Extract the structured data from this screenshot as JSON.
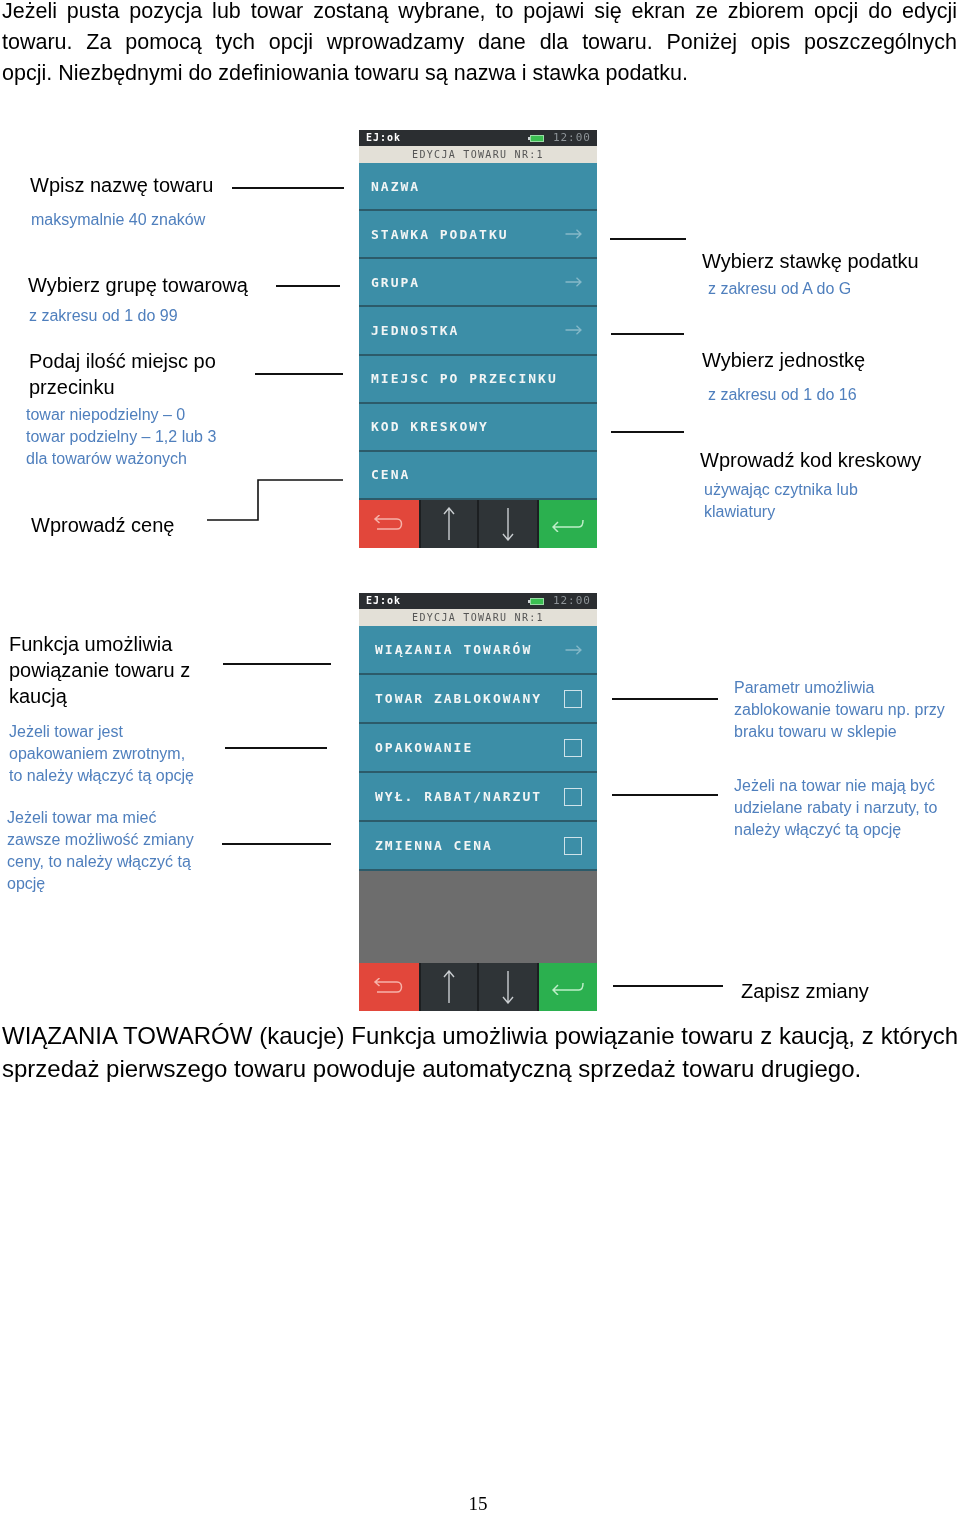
{
  "intro": [
    "Jeżeli pusta pozycja lub towar zostaną wybrane, to pojawi się ekran ze zbiorem opcji do edycji",
    "towaru. Za pomocą tych opcji wprowadzamy dane dla towaru. Poniżej opis poszczególnych",
    "opcji. Niezbędnymi do zdefiniowania towaru są nazwa i stawka podatku."
  ],
  "figures": [
    {
      "left": [
        {
          "kind": "title",
          "lines": [
            "Wpisz nazwę towaru"
          ]
        },
        {
          "kind": "note",
          "lines": [
            "maksymalnie 40 znaków"
          ]
        },
        {
          "kind": "title",
          "lines": [
            "Wybierz grupę towarową"
          ]
        },
        {
          "kind": "note",
          "lines": [
            "z zakresu od 1 do 99"
          ]
        },
        {
          "kind": "title",
          "lines": [
            "Podaj ilość miejsc po",
            "przecinku"
          ]
        },
        {
          "kind": "note",
          "lines": [
            "towar niepodzielny – 0",
            "towar podzielny – 1,2 lub 3",
            "dla towarów ważonych"
          ]
        },
        {
          "kind": "title",
          "lines": [
            "Wprowadź cenę"
          ]
        }
      ],
      "device": {
        "status_text": "EJ:ok",
        "time": "12:00",
        "title": "EDYCJA TOWARU NR:1",
        "items": [
          {
            "label": "NAZWA",
            "kind": "plain"
          },
          {
            "label": "STAWKA PODATKU",
            "kind": "arrow"
          },
          {
            "label": "GRUPA",
            "kind": "arrow"
          },
          {
            "label": "JEDNOSTKA",
            "kind": "arrow"
          },
          {
            "label": "MIEJSC PO PRZECINKU",
            "kind": "plain"
          },
          {
            "label": "KOD KRESKOWY",
            "kind": "plain"
          },
          {
            "label": "CENA",
            "kind": "plain"
          }
        ]
      },
      "right": [
        {
          "kind": "title",
          "lines": [
            "Wybierz stawkę podatku"
          ]
        },
        {
          "kind": "note",
          "lines": [
            "z zakresu od A do G"
          ]
        },
        {
          "kind": "title",
          "lines": [
            "Wybierz jednostkę"
          ]
        },
        {
          "kind": "note",
          "lines": [
            "z zakresu od 1 do 16"
          ]
        },
        {
          "kind": "title",
          "lines": [
            "Wprowadź kod kreskowy"
          ]
        },
        {
          "kind": "note",
          "lines": [
            "używając czytnika lub",
            "klawiatury"
          ]
        }
      ]
    },
    {
      "left": [
        {
          "kind": "title",
          "lines": [
            "Funkcja umożliwia",
            "powiązanie towaru z",
            "kaucją"
          ]
        },
        {
          "kind": "note",
          "lines": [
            "Jeżeli towar jest",
            "opakowaniem zwrotnym,",
            "to należy włączyć tą opcję"
          ]
        },
        {
          "kind": "note",
          "lines": [
            "Jeżeli towar ma mieć",
            "zawsze możliwość zmiany",
            "ceny, to należy włączyć tą",
            "opcję"
          ]
        }
      ],
      "device": {
        "status_text": "EJ:ok",
        "time": "12:00",
        "title": "EDYCJA TOWARU NR:1",
        "items": [
          {
            "label": "WIĄZANIA TOWARÓW",
            "kind": "arrow"
          },
          {
            "label": "TOWAR ZABLOKOWANY",
            "kind": "checkbox",
            "checked": false
          },
          {
            "label": "OPAKOWANIE",
            "kind": "checkbox",
            "checked": false
          },
          {
            "label": "WYŁ. RABAT/NARZUT",
            "kind": "checkbox",
            "checked": false
          },
          {
            "label": "ZMIENNA CENA",
            "kind": "checkbox",
            "checked": false
          }
        ]
      },
      "right": [
        {
          "kind": "note",
          "lines": [
            "Parametr umożliwia",
            "zablokowanie towaru np. przy",
            "braku towaru w sklepie"
          ]
        },
        {
          "kind": "note",
          "lines": [
            "Jeżeli na towar nie mają być",
            "udzielane rabaty i narzuty, to",
            "należy włączyć tą opcję"
          ]
        },
        {
          "kind": "title",
          "lines": [
            "Zapisz zmiany"
          ]
        }
      ]
    }
  ],
  "closing": "WIĄZANIA TOWARÓW (kaucje) Funkcja umożliwia powiązanie towaru z kaucją, z których sprzedaż pierwszego towaru powoduje automatyczną sprzedaż towaru drugiego.",
  "page_number": "15"
}
